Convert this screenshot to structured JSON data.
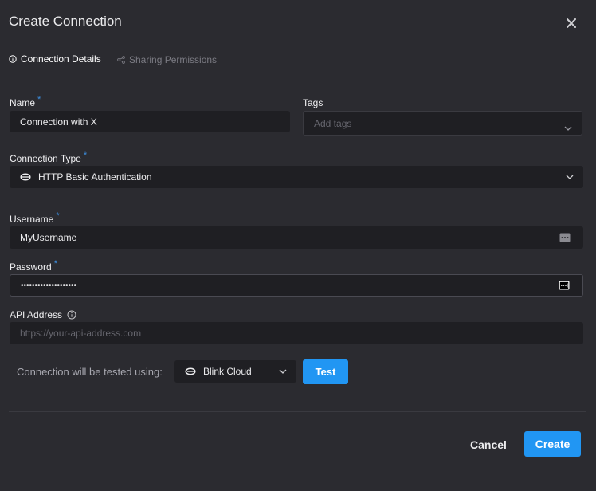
{
  "dialog": {
    "title": "Create Connection"
  },
  "tabs": [
    {
      "label": "Connection Details",
      "active": true
    },
    {
      "label": "Sharing Permissions",
      "active": false
    }
  ],
  "form": {
    "name": {
      "label": "Name",
      "required_mark": "*",
      "value": "Connection with X"
    },
    "tags": {
      "label": "Tags",
      "placeholder": "Add tags"
    },
    "connection_type": {
      "label": "Connection Type",
      "required_mark": "*",
      "value": "HTTP Basic Authentication"
    },
    "username": {
      "label": "Username",
      "required_mark": "*",
      "value": "MyUsername"
    },
    "password": {
      "label": "Password",
      "required_mark": "*",
      "value": "••••••••••••••••••••"
    },
    "api_address": {
      "label": "API Address",
      "placeholder": "https://your-api-address.com"
    }
  },
  "test": {
    "label": "Connection will be tested using:",
    "environment": "Blink Cloud",
    "button_label": "Test"
  },
  "footer": {
    "cancel_label": "Cancel",
    "create_label": "Create"
  },
  "colors": {
    "background": "#2b2b30",
    "field_background": "#1f1f23",
    "accent": "#2196f3",
    "required": "#3d8fe0"
  }
}
